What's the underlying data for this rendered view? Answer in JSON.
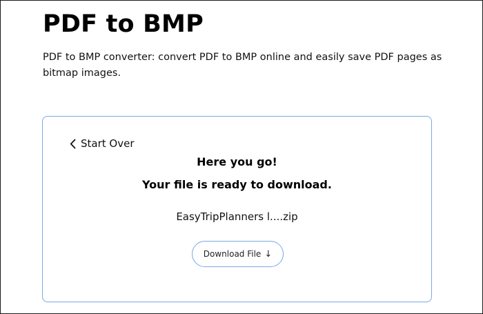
{
  "page": {
    "title": "PDF to BMP",
    "description": "PDF to BMP converter: convert PDF to BMP online and easily save PDF pages as bitmap images."
  },
  "result_card": {
    "start_over_label": "Start Over",
    "start_over_icon": "chevron-left-icon",
    "heading": "Here you go!",
    "subheading": "Your file is ready to download.",
    "file_name": "EasyTripPlanners l....zip",
    "download_label": "Download File",
    "download_icon": "↓",
    "border_color": "#7aa7e6"
  }
}
